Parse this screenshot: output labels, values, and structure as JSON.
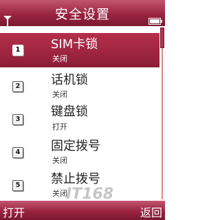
{
  "header": {
    "title": "安全设置",
    "signal_icon": "antenna-icon",
    "battery_icon": "battery-icon"
  },
  "menu": {
    "items": [
      {
        "number": "1",
        "label": "SIM卡锁",
        "value": "关闭",
        "selected": true
      },
      {
        "number": "2",
        "label": "话机锁",
        "value": "关闭",
        "selected": false
      },
      {
        "number": "3",
        "label": "键盘锁",
        "value": "打开",
        "selected": false
      },
      {
        "number": "4",
        "label": "固定拨号",
        "value": "关闭",
        "selected": false
      },
      {
        "number": "5",
        "label": "禁止拨号",
        "value": "关闭",
        "selected": false
      }
    ]
  },
  "softkeys": {
    "left": "打开",
    "right": "返回"
  },
  "watermark": "IT168",
  "colors": {
    "accent": "#9a2440",
    "selected": "#8c1c36"
  }
}
